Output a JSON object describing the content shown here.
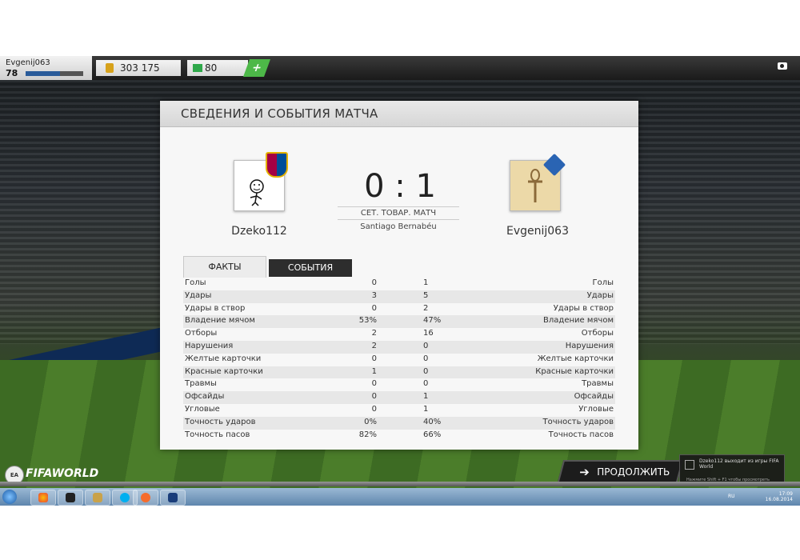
{
  "topbar": {
    "username": "Evgenij063",
    "level": "78",
    "xp_fraction": 0.6,
    "coins": "303 175",
    "points": "80",
    "plus_label": "+"
  },
  "panel": {
    "title": "СВЕДЕНИЯ И СОБЫТИЯ МАТЧА",
    "home_team": "Dzeko112",
    "away_team": "Evgenij063",
    "score": "0 : 1",
    "match_type": "СЕТ. ТОВАР. МАТЧ",
    "stadium": "Santiago Bernabéu",
    "tabs": [
      "ФАКТЫ",
      "СОБЫТИЯ"
    ],
    "stats": [
      {
        "label": "Голы",
        "home": "0",
        "away": "1"
      },
      {
        "label": "Удары",
        "home": "3",
        "away": "5"
      },
      {
        "label": "Удары в створ",
        "home": "0",
        "away": "2"
      },
      {
        "label": "Владение мячом",
        "home": "53%",
        "away": "47%"
      },
      {
        "label": "Отборы",
        "home": "2",
        "away": "16"
      },
      {
        "label": "Нарушения",
        "home": "2",
        "away": "0"
      },
      {
        "label": "Желтые карточки",
        "home": "0",
        "away": "0"
      },
      {
        "label": "Красные карточки",
        "home": "1",
        "away": "0"
      },
      {
        "label": "Травмы",
        "home": "0",
        "away": "0"
      },
      {
        "label": "Офсайды",
        "home": "0",
        "away": "1"
      },
      {
        "label": "Угловые",
        "home": "0",
        "away": "1"
      },
      {
        "label": "Точность ударов",
        "home": "0%",
        "away": "40%"
      },
      {
        "label": "Точность пасов",
        "home": "82%",
        "away": "66%"
      }
    ]
  },
  "continue_label": "ПРОДОЛЖИТЬ",
  "notification": {
    "text": "Dzeko112 выходит из игры FIFA World",
    "hint": "Нажмите Shift + F1 чтобы просмотреть"
  },
  "logo_text": "FIFAWORLD",
  "tray": {
    "lang": "RU",
    "time": "17:09",
    "date": "16.08.2014"
  },
  "colors": {
    "accent_green": "#4db848",
    "dark_button": "#1c1c1c",
    "xp_blue": "#2a5b9a"
  }
}
